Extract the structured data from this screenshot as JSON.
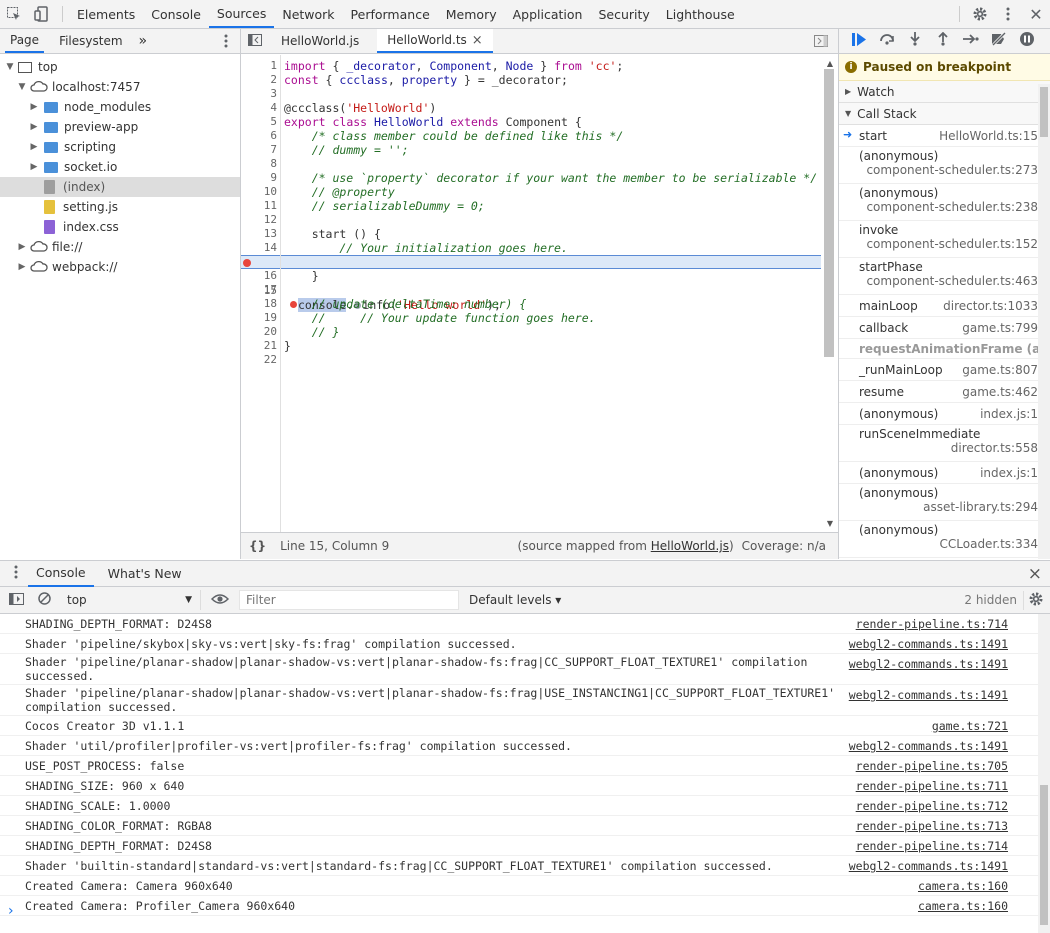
{
  "topbar": {
    "tabs": [
      "Elements",
      "Console",
      "Sources",
      "Network",
      "Performance",
      "Memory",
      "Application",
      "Security",
      "Lighthouse"
    ],
    "active_tab": "Sources"
  },
  "navigator": {
    "tabs": [
      "Page",
      "Filesystem"
    ],
    "more": "»",
    "tree": {
      "top": "top",
      "host": "localhost:7457",
      "folders": [
        "node_modules",
        "preview-app",
        "scripting",
        "socket.io"
      ],
      "files": [
        "(index)",
        "setting.js",
        "index.css"
      ],
      "roots": [
        "file://",
        "webpack://"
      ]
    }
  },
  "editor": {
    "tabs": [
      "HelloWorld.js",
      "HelloWorld.ts"
    ],
    "close": "×",
    "line_numbers": [
      "1",
      "2",
      "3",
      "4",
      "5",
      "6",
      "7",
      "8",
      "9",
      "10",
      "11",
      "12",
      "13",
      "14",
      "15",
      "16",
      "17",
      "18",
      "19",
      "20",
      "21",
      "22"
    ],
    "code": {
      "l1a": "import",
      "l1b": " { ",
      "l1c": "_decorator",
      "l1d": ", ",
      "l1e": "Component",
      "l1f": ", ",
      "l1g": "Node",
      "l1h": " } ",
      "l1i": "from",
      "l1j": " 'cc'",
      "l1k": ";",
      "l2a": "const",
      "l2b": " { ",
      "l2c": "ccclass",
      "l2d": ", ",
      "l2e": "property",
      "l2f": " } = _decorator;",
      "l4a": "@ccclass(",
      "l4b": "'HelloWorld'",
      "l4c": ")",
      "l5a": "export",
      "l5b": " ",
      "l5c": "class",
      "l5d": " ",
      "l5e": "HelloWorld",
      "l5f": " ",
      "l5g": "extends",
      "l5h": " Component {",
      "l6": "    /* class member could be defined like this */",
      "l7": "    // dummy = '';",
      "l9": "    /* use `property` decorator if your want the member to be serializable */",
      "l10": "    // @property",
      "l11": "    // serializableDummy = 0;",
      "l13": "    start () {",
      "l14": "        // Your initialization goes here.",
      "l15a": "console",
      "l15b": ".",
      "l15c": "info(",
      "l15d": "'Hello world'",
      "l15e": ");",
      "l16": "    }",
      "l18": "    // update (deltaTime: number) {",
      "l19": "    //     // Your update function goes here.",
      "l20": "    // }",
      "l21": "}"
    },
    "status": {
      "braces": "{}",
      "position": "Line 15, Column 9",
      "mapped_prefix": "(source mapped from ",
      "mapped_file": "HelloWorld.js",
      "mapped_suffix": ")",
      "coverage": "Coverage: n/a"
    }
  },
  "debugger": {
    "paused": "Paused on breakpoint",
    "watch": "Watch",
    "call_stack": "Call Stack",
    "frames": [
      {
        "fn": "start",
        "loc": "HelloWorld.ts:15",
        "wrap": false,
        "current": true
      },
      {
        "fn": "(anonymous)",
        "loc": "component-scheduler.ts:273",
        "wrap": true
      },
      {
        "fn": "(anonymous)",
        "loc": "component-scheduler.ts:238",
        "wrap": true
      },
      {
        "fn": "invoke",
        "loc": "component-scheduler.ts:152",
        "wrap": true
      },
      {
        "fn": "startPhase",
        "loc": "component-scheduler.ts:463",
        "wrap": true
      },
      {
        "fn": "mainLoop",
        "loc": "director.ts:1033",
        "wrap": false
      },
      {
        "fn": "callback",
        "loc": "game.ts:799",
        "wrap": false
      },
      {
        "fn": "requestAnimationFrame (a...",
        "loc": "",
        "async": true
      },
      {
        "fn": "_runMainLoop",
        "loc": "game.ts:807",
        "wrap": false
      },
      {
        "fn": "resume",
        "loc": "game.ts:462",
        "wrap": false
      },
      {
        "fn": "(anonymous)",
        "loc": "index.js:1",
        "wrap": false
      },
      {
        "fn": "runSceneImmediate",
        "loc": "director.ts:558",
        "wrap": true
      },
      {
        "fn": "(anonymous)",
        "loc": "index.js:1",
        "wrap": false
      },
      {
        "fn": "(anonymous)",
        "loc": "asset-library.ts:294",
        "wrap": true
      },
      {
        "fn": "(anonymous)",
        "loc": "CCLoader.ts:334",
        "wrap": true
      }
    ]
  },
  "drawer": {
    "tabs": [
      "Console",
      "What's New"
    ],
    "close": "×",
    "context": "top",
    "filter_placeholder": "Filter",
    "levels": "Default levels ▾",
    "hidden": "2 hidden",
    "messages": [
      {
        "text": "SHADING_DEPTH_FORMAT: D24S8",
        "src": "render-pipeline.ts:714"
      },
      {
        "text": "Shader 'pipeline/skybox|sky-vs:vert|sky-fs:frag' compilation successed.",
        "src": "webgl2-commands.ts:1491"
      },
      {
        "text": "Shader 'pipeline/planar-shadow|planar-shadow-vs:vert|planar-shadow-fs:frag|CC_SUPPORT_FLOAT_TEXTURE1' compilation successed.",
        "src": "webgl2-commands.ts:1491"
      },
      {
        "text": "Shader 'pipeline/planar-shadow|planar-shadow-vs:vert|planar-shadow-fs:frag|USE_INSTANCING1|CC_SUPPORT_FLOAT_TEXTURE1'\ncompilation successed.",
        "src": "webgl2-commands.ts:1491"
      },
      {
        "text": "Cocos Creator 3D v1.1.1",
        "src": "game.ts:721"
      },
      {
        "text": "Shader 'util/profiler|profiler-vs:vert|profiler-fs:frag' compilation successed.",
        "src": "webgl2-commands.ts:1491"
      },
      {
        "text": "USE_POST_PROCESS: false",
        "src": "render-pipeline.ts:705"
      },
      {
        "text": "SHADING_SIZE: 960 x 640",
        "src": "render-pipeline.ts:711"
      },
      {
        "text": "SHADING_SCALE: 1.0000",
        "src": "render-pipeline.ts:712"
      },
      {
        "text": "SHADING_COLOR_FORMAT: RGBA8",
        "src": "render-pipeline.ts:713"
      },
      {
        "text": "SHADING_DEPTH_FORMAT: D24S8",
        "src": "render-pipeline.ts:714"
      },
      {
        "text": "Shader 'builtin-standard|standard-vs:vert|standard-fs:frag|CC_SUPPORT_FLOAT_TEXTURE1' compilation successed.",
        "src": "webgl2-commands.ts:1491"
      },
      {
        "text": "Created Camera: Camera 960x640",
        "src": "camera.ts:160"
      },
      {
        "text": "Created Camera: Profiler_Camera 960x640",
        "src": "camera.ts:160"
      }
    ],
    "prompt": "›"
  }
}
